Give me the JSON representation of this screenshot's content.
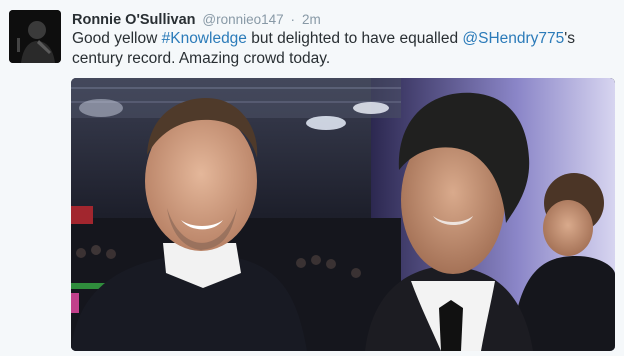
{
  "tweet": {
    "author_name": "Ronnie O'Sullivan",
    "handle": "@ronnieo147",
    "separator": "·",
    "time": "2m",
    "text_parts": {
      "part1": "Good yellow ",
      "hashtag": "#Knowledge",
      "part2": " but delighted to have equalled ",
      "mention": "@SHendry775",
      "part3": "'s century record. Amazing crowd today."
    }
  },
  "icons": {
    "avatar": "profile-avatar-photo"
  },
  "colors": {
    "link": "#2b7bb9",
    "name": "#292f33",
    "meta": "#8899a6",
    "background": "#f5f8fa"
  }
}
